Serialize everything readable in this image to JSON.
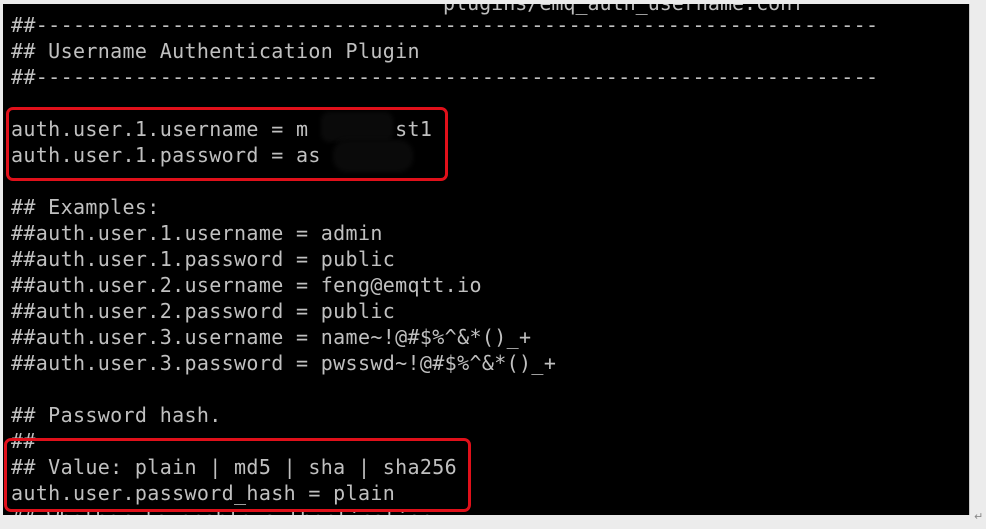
{
  "terminal": {
    "top_partial": "plugins/emq_auth_username.conf",
    "lines": [
      "##--------------------------------------------------------------------",
      "## Username Authentication Plugin",
      "##--------------------------------------------------------------------",
      "",
      "auth.user.1.username = m       st1",
      "auth.user.1.password = as      5",
      "",
      "## Examples:",
      "##auth.user.1.username = admin",
      "##auth.user.1.password = public",
      "##auth.user.2.username = feng@emqtt.io",
      "##auth.user.2.password = public",
      "##auth.user.3.username = name~!@#$%^&*()_+",
      "##auth.user.3.password = pwsswd~!@#$%^&*()_+",
      "",
      "## Password hash.",
      "##",
      "## Value: plain | md5 | sha | sha256",
      "auth.user.password_hash = plain"
    ],
    "bottom_partial": "## Whether to enable authentication"
  },
  "highlight_color": "#e0101a",
  "paragraph_mark": "↵"
}
